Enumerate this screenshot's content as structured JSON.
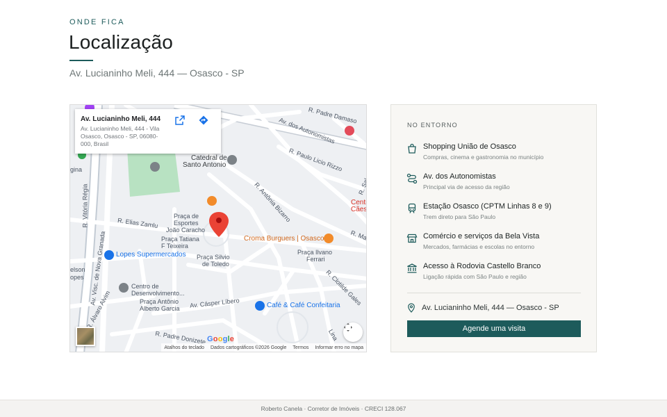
{
  "section": {
    "eyebrow": "ONDE FICA",
    "title": "Localização",
    "address": "Av. Lucianinho Meli, 444 — Osasco - SP"
  },
  "map": {
    "info_card": {
      "title": "Av. Lucianinho Meli, 444",
      "address": "Av. Lucianinho Meli, 444 - Vila Osasco, Osasco - SP, 06080-000, Brasil",
      "open_icon": "open-in-new-icon",
      "directions_icon": "directions-icon"
    },
    "labels": {
      "pde": "R. Padre Damaso",
      "autonomistas": "Av. dos Autonomistas",
      "licio": "R. Paulo Licio Rizzo",
      "belchior": "R. Salem Bechara",
      "catedral": "Catedral de",
      "catedral2": "Santo Antonio",
      "antonia": "R. Antônia Bizarro",
      "centro": "Centr",
      "centro2": "Cães",
      "machado": "R. Macho",
      "gina": "gina",
      "vitoria": "R. Vitória Régia",
      "granada": "Av. Visc. de Nova Granada",
      "elias": "R. Elias Zamlu",
      "praca_esportes": "Praça de",
      "praca_esportes2": "Esportes",
      "praca_esportes3": "João Caracho",
      "praca_tatiana": "Praça Tatiana",
      "praca_tatiana2": "F Teixeira",
      "croma": "Croma Burguers | Osasco",
      "lopes": "Lopes Supermercados",
      "nelson": "elson",
      "opes": "opes",
      "silvio": "Praça Silvio",
      "silvio2": "de Toledo",
      "ilvano": "Praça Ilvano",
      "ilvano2": "Ferrari",
      "clotilde": "R. Clotilde Gales",
      "centro_desenv": "Centro de",
      "centro_desenv2": "Desenvolvimento...",
      "praca_antonio": "Praça Antônio",
      "praca_antonio2": "Alberto Garcia",
      "alvino": "R. Álvaro Alvim",
      "casper": "Av. Cásper Líbero",
      "cafe": "Café & Café Confeitaria",
      "donizete": "R. Padre Donizete",
      "lina": "Lina"
    },
    "google_logo": "Google",
    "footer": {
      "shortcuts": "Atalhos do teclado",
      "data": "Dados cartográficos ©2026 Google",
      "terms": "Termos",
      "report": "Informar erro no mapa"
    },
    "icons": {
      "pin": "map-pin-icon",
      "fullscreen": "fullscreen-icon",
      "satellite": "satellite-thumbnail"
    }
  },
  "panel": {
    "heading": "NO ENTORNO",
    "items": [
      {
        "icon": "shopping-bag-icon",
        "title": "Shopping União de Osasco",
        "subtitle": "Compras, cinema e gastronomia no município"
      },
      {
        "icon": "route-icon",
        "title": "Av. dos Autonomistas",
        "subtitle": "Principal via de acesso da região"
      },
      {
        "icon": "train-icon",
        "title": "Estação Osasco (CPTM Linhas 8 e 9)",
        "subtitle": "Trem direto para São Paulo"
      },
      {
        "icon": "store-icon",
        "title": "Comércio e serviços da Bela Vista",
        "subtitle": "Mercados, farmácias e escolas no entorno"
      },
      {
        "icon": "landmark-icon",
        "title": "Acesso à Rodovia Castello Branco",
        "subtitle": "Ligação rápida com São Paulo e região"
      }
    ],
    "location": "Av. Lucianinho Meli, 444 — Osasco - SP",
    "cta": "Agende uma visita"
  },
  "footer": {
    "text": "Roberto Canela · Corretor de Imóveis · CRECI 128.067"
  },
  "colors": {
    "accent": "#1d5b5b",
    "pin": "#ea4335"
  }
}
